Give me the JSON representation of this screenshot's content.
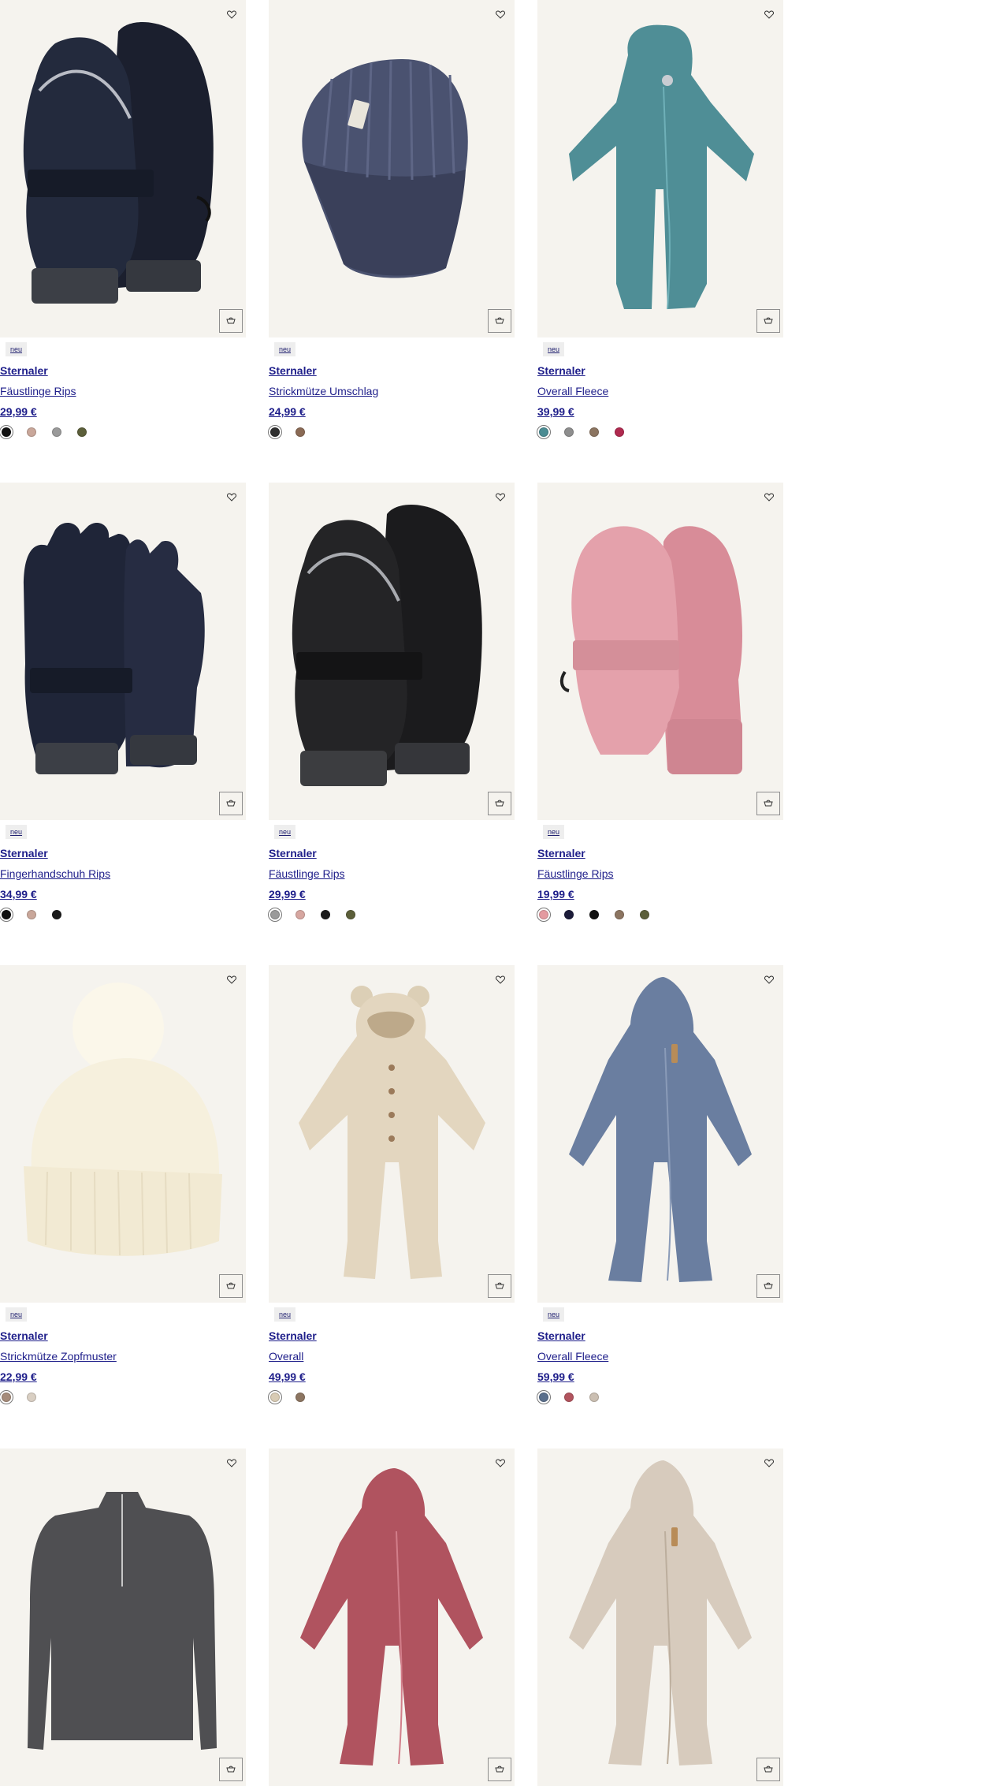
{
  "badge_label": "neu",
  "products": [
    {
      "badge": "neu",
      "brand": "Sternaler",
      "name": "Fäustlinge Rips",
      "price": "29,99 €",
      "image": "mittens-navy",
      "swatches": [
        "#111111",
        "#c9a79a",
        "#9a9a9a",
        "#5c5f3a"
      ],
      "selected": 0
    },
    {
      "badge": "neu",
      "brand": "Sternaler",
      "name": "Strickmütze Umschlag",
      "price": "24,99 €",
      "image": "beanie-blue",
      "swatches": [
        "#2f2f2f",
        "#8a6a55"
      ],
      "selected": 0
    },
    {
      "badge": "neu",
      "brand": "Sternaler",
      "name": "Overall Fleece",
      "price": "39,99 €",
      "image": "overall-teal",
      "swatches": [
        "#4b8c93",
        "#8e8e8e",
        "#8c7561",
        "#b02a4f"
      ],
      "selected": 0
    },
    {
      "badge": "neu",
      "brand": "Sternaler",
      "name": "Fingerhandschuh Rips",
      "price": "34,99 €",
      "image": "gloves-navy",
      "swatches": [
        "#111111",
        "#c9a79a",
        "#1a1a1a"
      ],
      "selected": 0
    },
    {
      "badge": "neu",
      "brand": "Sternaler",
      "name": "Fäustlinge Rips",
      "price": "29,99 €",
      "image": "mittens-black",
      "swatches": [
        "#9a9a9a",
        "#d6a6a0",
        "#1a1a1a",
        "#5c5f3a"
      ],
      "selected": 0
    },
    {
      "badge": "neu",
      "brand": "Sternaler",
      "name": "Fäustlinge Rips",
      "price": "19,99 €",
      "image": "mittens-pink",
      "swatches": [
        "#e49aa0",
        "#1c1c3a",
        "#111111",
        "#8c7561",
        "#5c5f3a"
      ],
      "selected": 0
    },
    {
      "badge": "neu",
      "brand": "Sternaler",
      "name": "Strickmütze Zopfmuster",
      "price": "22,99 €",
      "image": "pompom-cream",
      "swatches": [
        "#a58b7a",
        "#d9cfc3"
      ],
      "selected": 0
    },
    {
      "badge": "neu",
      "brand": "Sternaler",
      "name": "Overall",
      "price": "49,99 €",
      "image": "overall-beige",
      "swatches": [
        "#d8cbb4",
        "#8c7561"
      ],
      "selected": 0
    },
    {
      "badge": "neu",
      "brand": "Sternaler",
      "name": "Overall Fleece",
      "price": "59,99 €",
      "image": "overall-blue",
      "swatches": [
        "#5a6f8c",
        "#b2545e",
        "#cbbfb2"
      ],
      "selected": 0
    },
    {
      "badge": "",
      "brand": "",
      "name": "",
      "price": "",
      "image": "sweater-grey",
      "swatches": [],
      "selected": -1
    },
    {
      "badge": "",
      "brand": "",
      "name": "",
      "price": "",
      "image": "overall-rose",
      "swatches": [],
      "selected": -1
    },
    {
      "badge": "",
      "brand": "",
      "name": "",
      "price": "",
      "image": "overall-sand",
      "swatches": [],
      "selected": -1
    }
  ]
}
